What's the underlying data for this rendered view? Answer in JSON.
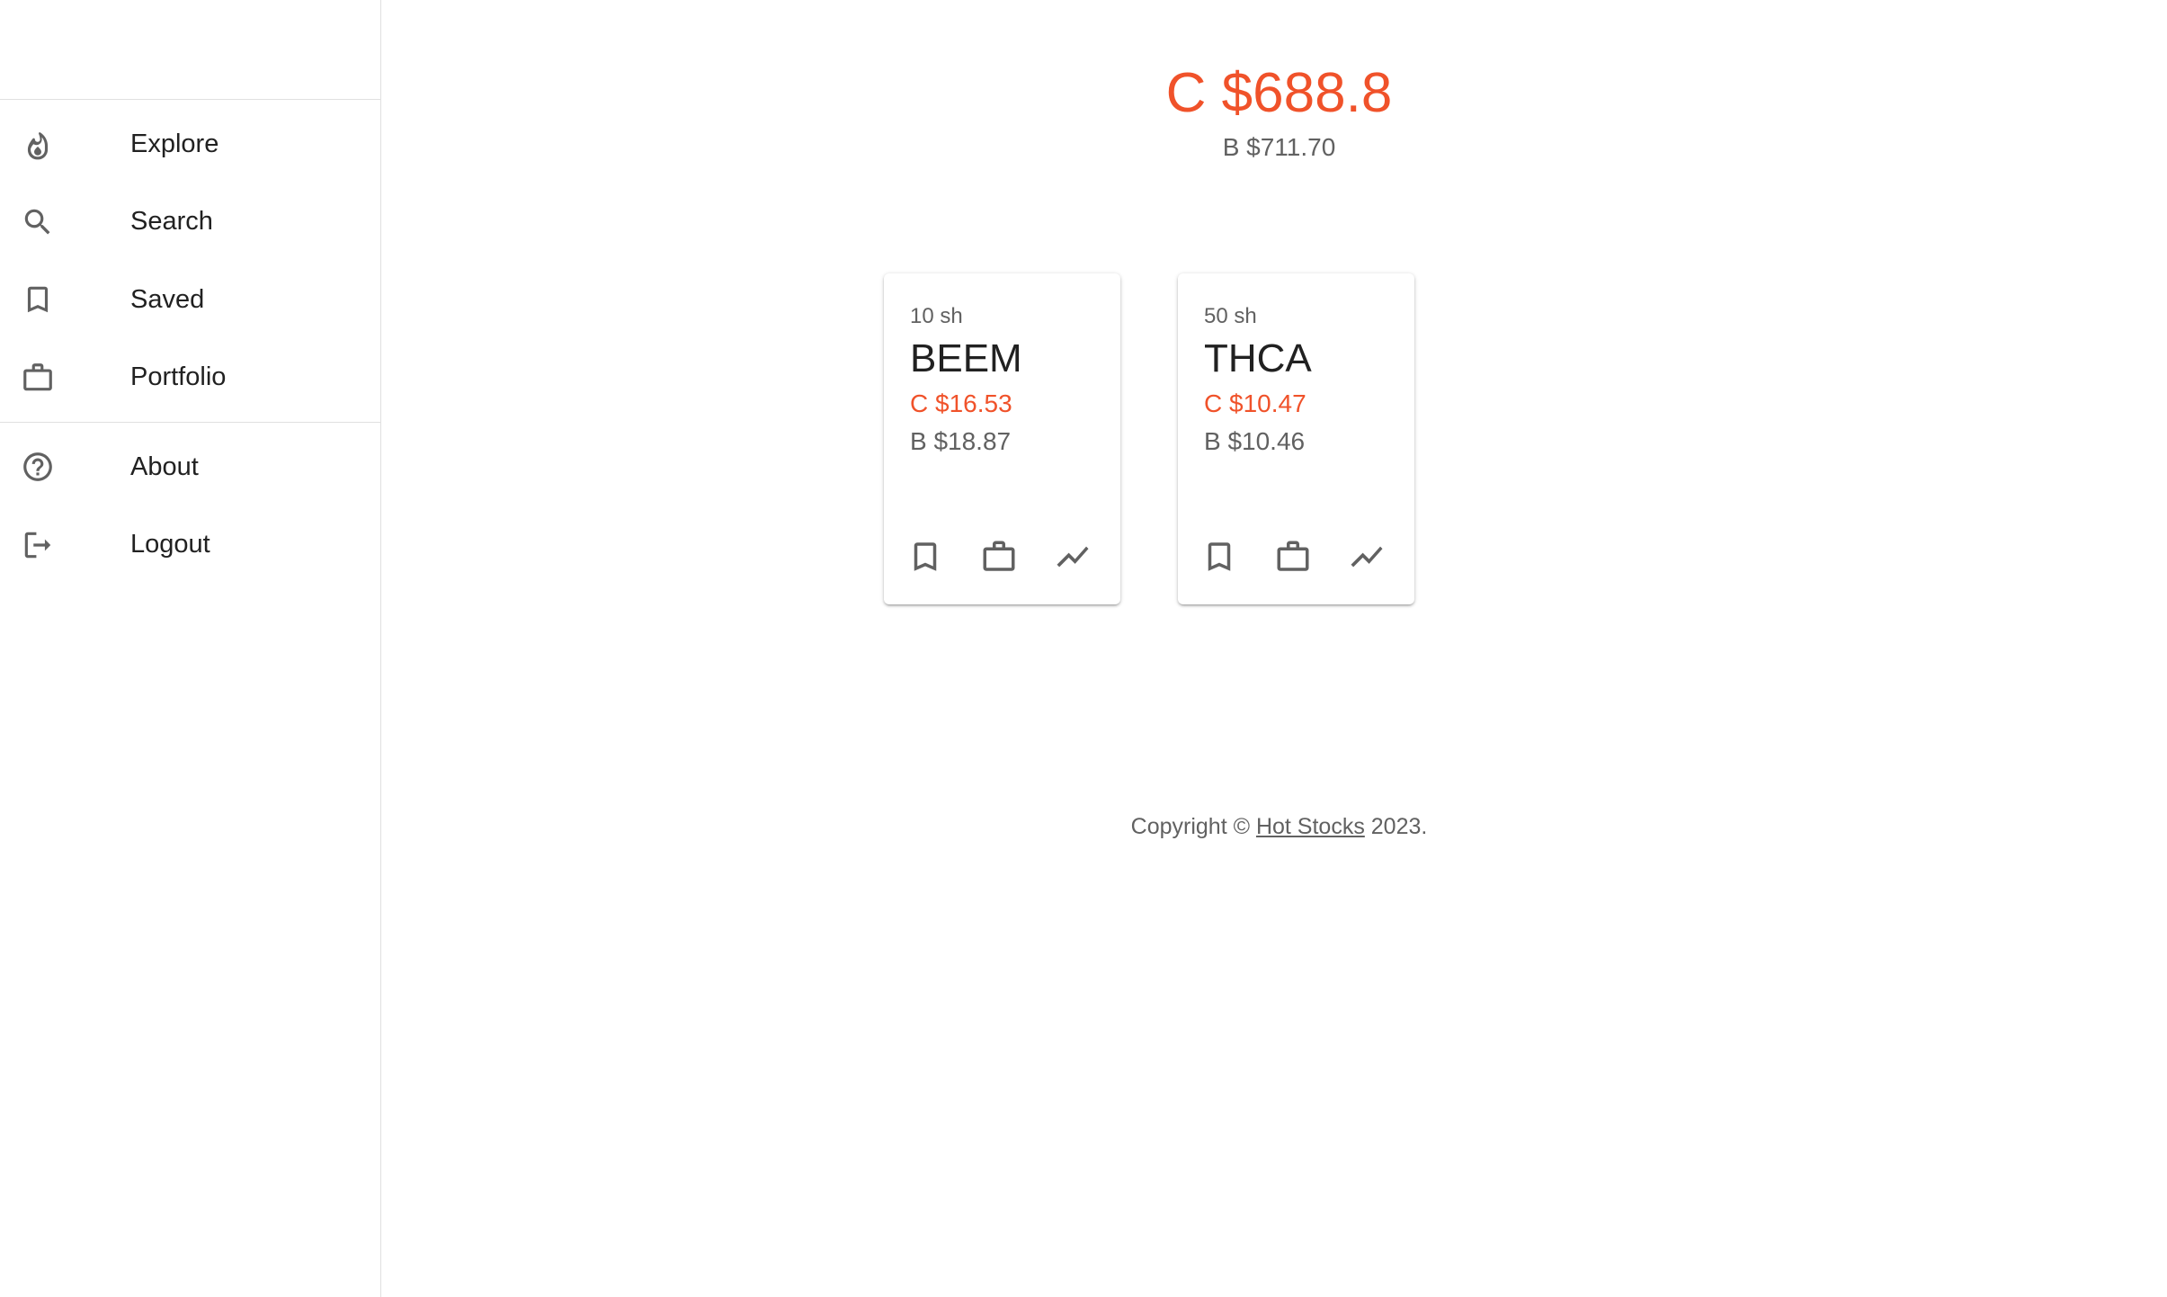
{
  "sidebar": {
    "primary_items": [
      {
        "label": "Explore",
        "icon": "flame-icon"
      },
      {
        "label": "Search",
        "icon": "search-icon"
      },
      {
        "label": "Saved",
        "icon": "bookmark-icon"
      },
      {
        "label": "Portfolio",
        "icon": "briefcase-icon"
      }
    ],
    "secondary_items": [
      {
        "label": "About",
        "icon": "help-circle-icon"
      },
      {
        "label": "Logout",
        "icon": "logout-icon"
      }
    ]
  },
  "summary": {
    "current_value": "C $688.8",
    "basis_value": "B $711.70"
  },
  "holdings": [
    {
      "shares": "10 sh",
      "symbol": "BEEM",
      "current": "C $16.53",
      "basis": "B $18.87"
    },
    {
      "shares": "50 sh",
      "symbol": "THCA",
      "current": "C $10.47",
      "basis": "B $10.46"
    }
  ],
  "footer": {
    "prefix": "Copyright © ",
    "link": "Hot Stocks",
    "suffix": " 2023."
  },
  "colors": {
    "accent": "#f0522a",
    "muted_text": "#616161",
    "divider": "#e0e0e0"
  }
}
